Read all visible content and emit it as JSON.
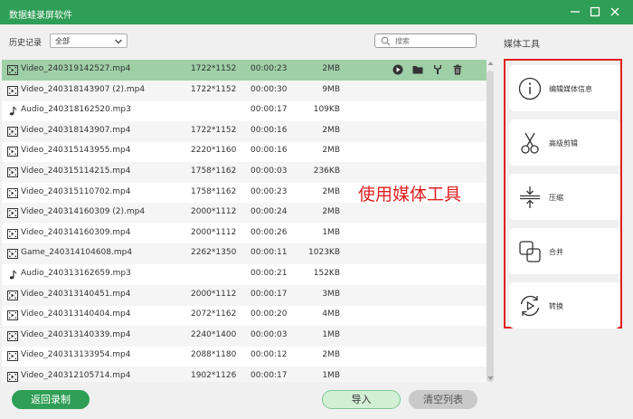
{
  "window": {
    "title": "数据蛙录屏软件"
  },
  "filter": {
    "label": "历史记录",
    "selected": "全部"
  },
  "search": {
    "placeholder": "搜索"
  },
  "files": [
    {
      "type": "video",
      "name": "Video_240319142527.mp4",
      "resolution": "1722*1152",
      "duration": "00:00:23",
      "size": "2MB"
    },
    {
      "type": "video",
      "name": "Video_240318143907 (2).mp4",
      "resolution": "1722*1152",
      "duration": "00:00:30",
      "size": "9MB"
    },
    {
      "type": "audio",
      "name": "Audio_240318162520.mp3",
      "resolution": "",
      "duration": "00:00:17",
      "size": "109KB"
    },
    {
      "type": "video",
      "name": "Video_240318143907.mp4",
      "resolution": "1722*1152",
      "duration": "00:00:16",
      "size": "2MB"
    },
    {
      "type": "video",
      "name": "Video_240315143955.mp4",
      "resolution": "2220*1160",
      "duration": "00:00:16",
      "size": "2MB"
    },
    {
      "type": "video",
      "name": "Video_240315114215.mp4",
      "resolution": "1758*1162",
      "duration": "00:00:03",
      "size": "236KB"
    },
    {
      "type": "video",
      "name": "Video_240315110702.mp4",
      "resolution": "1758*1162",
      "duration": "00:00:23",
      "size": "2MB"
    },
    {
      "type": "video",
      "name": "Video_240314160309 (2).mp4",
      "resolution": "2000*1112",
      "duration": "00:00:24",
      "size": "2MB"
    },
    {
      "type": "video",
      "name": "Video_240314160309.mp4",
      "resolution": "2000*1112",
      "duration": "00:00:26",
      "size": "1MB"
    },
    {
      "type": "video",
      "name": "Game_240314104608.mp4",
      "resolution": "2262*1350",
      "duration": "00:00:11",
      "size": "1023KB"
    },
    {
      "type": "audio",
      "name": "Audio_240313162659.mp3",
      "resolution": "",
      "duration": "00:00:21",
      "size": "152KB"
    },
    {
      "type": "video",
      "name": "Video_240313140451.mp4",
      "resolution": "2000*1112",
      "duration": "00:00:17",
      "size": "3MB"
    },
    {
      "type": "video",
      "name": "Video_240313140404.mp4",
      "resolution": "2072*1162",
      "duration": "00:00:20",
      "size": "4MB"
    },
    {
      "type": "video",
      "name": "Video_240313140339.mp4",
      "resolution": "2240*1400",
      "duration": "00:00:03",
      "size": "1MB"
    },
    {
      "type": "video",
      "name": "Video_240313133954.mp4",
      "resolution": "2088*1180",
      "duration": "00:00:12",
      "size": "2MB"
    },
    {
      "type": "video",
      "name": "Video_240312105714.mp4",
      "resolution": "1902*1126",
      "duration": "00:00:17",
      "size": "1MB"
    }
  ],
  "row_actions": [
    "play-icon",
    "folder-icon",
    "tools-icon",
    "trash-icon"
  ],
  "buttons": {
    "back": "返回录制",
    "import": "导入",
    "clear": "清空列表"
  },
  "tools": {
    "title": "媒体工具",
    "items": [
      {
        "label": "编辑媒体信息",
        "icon": "info-icon"
      },
      {
        "label": "高级剪辑",
        "icon": "scissors-icon"
      },
      {
        "label": "压缩",
        "icon": "compress-icon"
      },
      {
        "label": "合并",
        "icon": "merge-icon"
      },
      {
        "label": "转换",
        "icon": "convert-icon"
      }
    ]
  },
  "annotation": "使用媒体工具",
  "colors": {
    "brand_green": "#2f9e56",
    "selected_row": "#9fcfa7",
    "highlight_red": "#e02020"
  }
}
